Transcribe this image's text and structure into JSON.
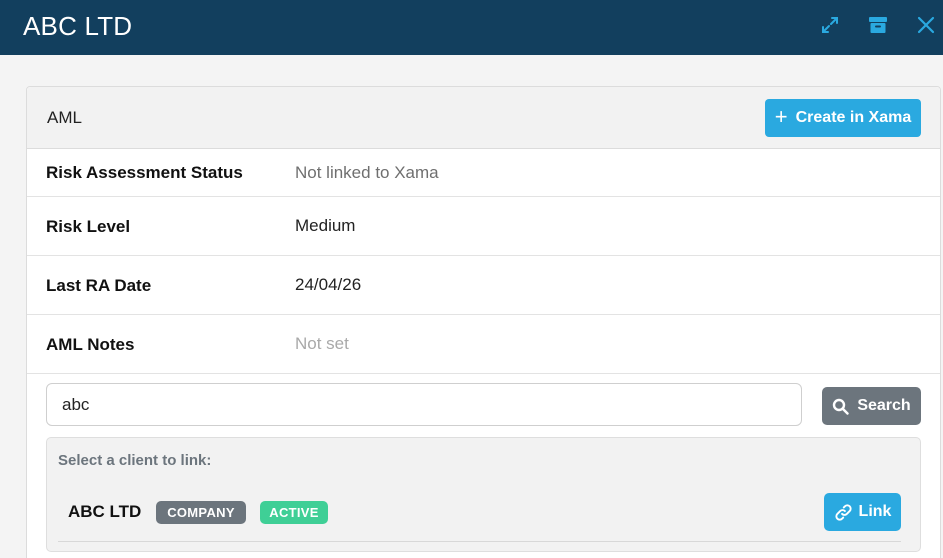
{
  "window": {
    "title": "ABC LTD",
    "icons": [
      "expand-icon",
      "archive-icon",
      "close-icon"
    ]
  },
  "aml": {
    "title": "AML",
    "create_button": "Create in Xama",
    "rows": [
      {
        "label": "Risk Assessment Status",
        "value": "Not linked to Xama"
      },
      {
        "label": "Risk Level",
        "value": "Medium"
      },
      {
        "label": "Last RA Date",
        "value": "24/04/26"
      },
      {
        "label": "AML Notes",
        "value": "Not set"
      }
    ]
  },
  "search": {
    "value": "abc",
    "button": "Search"
  },
  "results": {
    "prompt": "Select a client to link:",
    "client": {
      "name": "ABC LTD",
      "type_badge": "COMPANY",
      "status_badge": "ACTIVE",
      "link_button": "Link"
    }
  },
  "colors": {
    "header_bg": "#123f5e",
    "accent": "#2aa9e0",
    "secondary": "#6c757d",
    "active_badge": "#3fcf96"
  }
}
